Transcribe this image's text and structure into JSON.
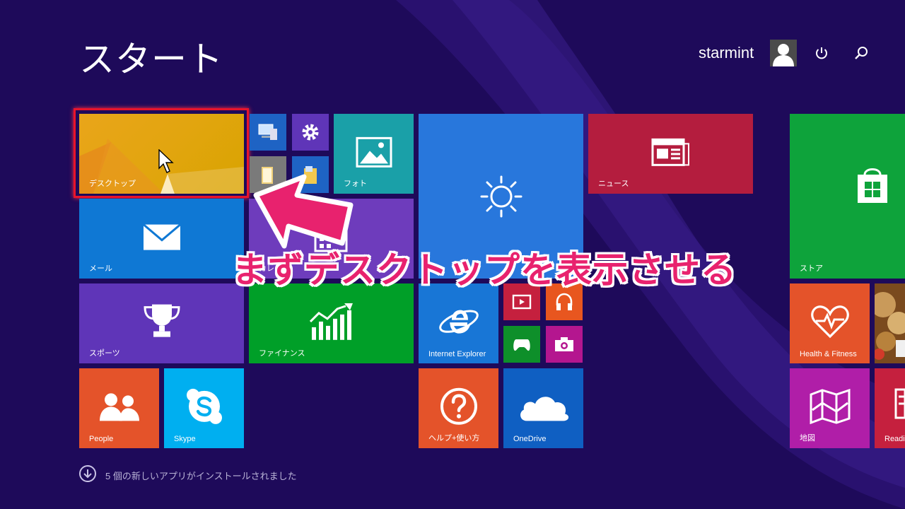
{
  "header": {
    "title": "スタート",
    "user_name": "starmint"
  },
  "tiles": {
    "desktop": "デスクトップ",
    "photos": "フォト",
    "news": "ニュース",
    "store": "ストア",
    "mail": "メール",
    "calendar": "カレ",
    "sports": "スポーツ",
    "finance": "ファイナンス",
    "ie": "Internet Explorer",
    "health": "Health & Fitness",
    "people": "People",
    "skype": "Skype",
    "help": "ヘルプ+使い方",
    "onedrive": "OneDrive",
    "maps": "地図",
    "reading": "Readi"
  },
  "annotation": {
    "text": "まずデスクトップを表示させる"
  },
  "footer": {
    "install_text": "5 個の新しいアプリがインストールされました"
  },
  "colors": {
    "background": "#1e0a5a",
    "highlight": "#e8142c",
    "annotation_text": "#e8226e"
  },
  "icons": {
    "power": "power-icon",
    "search": "search-icon",
    "install": "download-arrow-icon"
  }
}
